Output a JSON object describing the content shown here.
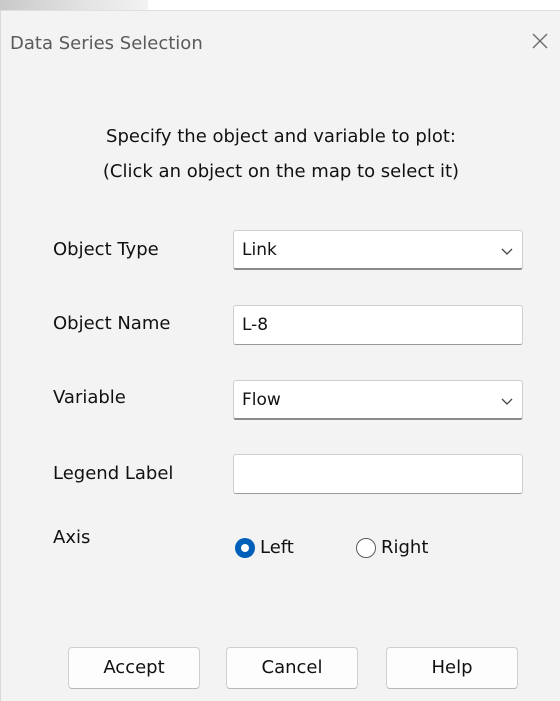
{
  "window": {
    "title": "Data Series Selection",
    "close_icon": "close-icon"
  },
  "instructions": {
    "line1": "Specify the object and variable to plot:",
    "line2": "(Click an object on the map to select it)"
  },
  "fields": {
    "object_type": {
      "label": "Object Type",
      "value": "Link"
    },
    "object_name": {
      "label": "Object Name",
      "value": "L-8"
    },
    "variable": {
      "label": "Variable",
      "value": "Flow"
    },
    "legend_label": {
      "label": "Legend Label",
      "value": ""
    }
  },
  "axis": {
    "label": "Axis",
    "options": [
      {
        "label": "Left",
        "selected": true
      },
      {
        "label": "Right",
        "selected": false
      }
    ]
  },
  "buttons": {
    "accept": "Accept",
    "cancel": "Cancel",
    "help": "Help"
  },
  "colors": {
    "accent": "#005fb8",
    "dialog_bg": "#f3f3f3"
  }
}
